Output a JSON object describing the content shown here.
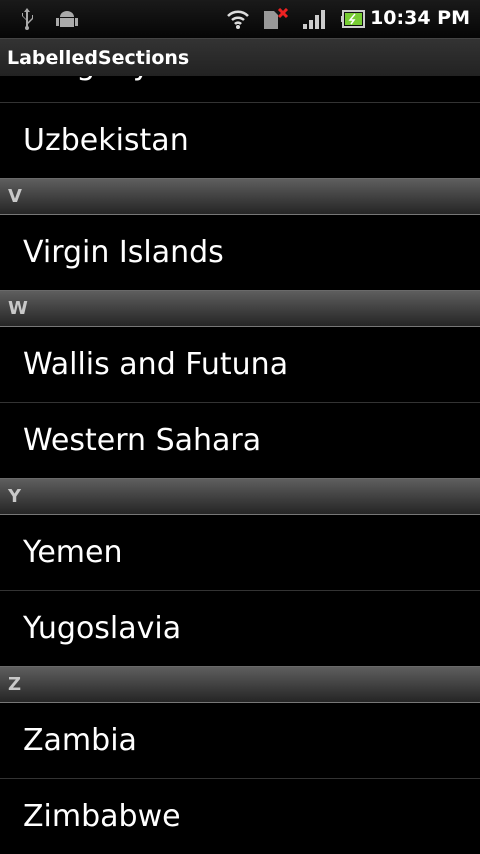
{
  "status_bar": {
    "time": "10:34 PM",
    "icons": [
      "usb-icon",
      "android-debug-icon",
      "wifi-icon",
      "no-sim-icon",
      "signal-icon",
      "battery-charging-icon"
    ]
  },
  "app": {
    "title": "LabelledSections"
  },
  "list": [
    {
      "type": "item",
      "label": "Uruguay"
    },
    {
      "type": "item",
      "label": "Uzbekistan"
    },
    {
      "type": "header",
      "label": "V"
    },
    {
      "type": "item",
      "label": "Virgin Islands"
    },
    {
      "type": "header",
      "label": "W"
    },
    {
      "type": "item",
      "label": "Wallis and Futuna"
    },
    {
      "type": "item",
      "label": "Western Sahara"
    },
    {
      "type": "header",
      "label": "Y"
    },
    {
      "type": "item",
      "label": "Yemen"
    },
    {
      "type": "item",
      "label": "Yugoslavia"
    },
    {
      "type": "header",
      "label": "Z"
    },
    {
      "type": "item",
      "label": "Zambia"
    },
    {
      "type": "item",
      "label": "Zimbabwe"
    }
  ]
}
